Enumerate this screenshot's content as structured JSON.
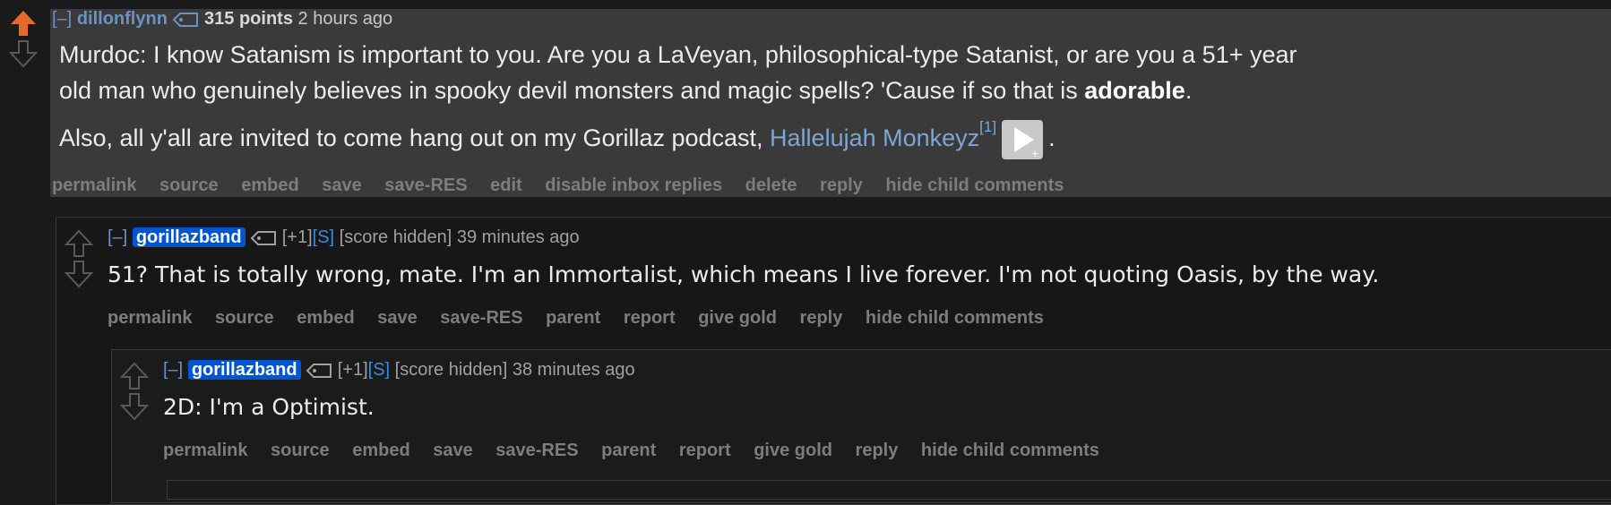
{
  "comment1": {
    "toggle": "[–]",
    "author": "dillonflynn",
    "points": "315 points",
    "time": "2 hours ago",
    "body_p1_before": "Murdoc: I know Satanism is important to you. Are you a LaVeyan, philosophical-type Satanist, or are you a 51+ year",
    "body_p1_line2": "old man who genuinely believes in spooky devil monsters and magic spells? 'Cause if so that is ",
    "body_p1_bold": "adorable",
    "body_p1_end": ".",
    "body_p2_before": "Also, all y'all are invited to come hang out on my Gorillaz podcast, ",
    "body_p2_link": "Hallelujah Monkeyz",
    "body_p2_sup": "[1]",
    "body_p2_end": ".",
    "buttons": [
      "permalink",
      "source",
      "embed",
      "save",
      "save-RES",
      "edit",
      "disable inbox replies",
      "delete",
      "reply",
      "hide child comments"
    ]
  },
  "comment2": {
    "toggle": "[–]",
    "author": "gorillazband",
    "flair_plus": "[+1]",
    "flair_s": "[S]",
    "score": "[score hidden]",
    "time": "39 minutes ago",
    "body": "51? That is totally wrong, mate. I'm an Immortalist, which means I live forever. I'm not quoting Oasis, by the way.",
    "buttons": [
      "permalink",
      "source",
      "embed",
      "save",
      "save-RES",
      "parent",
      "report",
      "give gold",
      "reply",
      "hide child comments"
    ]
  },
  "comment3": {
    "toggle": "[–]",
    "author": "gorillazband",
    "flair_plus": "[+1]",
    "flair_s": "[S]",
    "score": "[score hidden]",
    "time": "38 minutes ago",
    "body": "2D: I'm a Optimist.",
    "buttons": [
      "permalink",
      "source",
      "embed",
      "save",
      "save-RES",
      "parent",
      "report",
      "give gold",
      "reply",
      "hide child comments"
    ]
  },
  "icons": {
    "upvote_active_color": "#e8682a",
    "arrow_inactive_color": "#5a5a5a",
    "tag": "tag-icon",
    "play": "play-icon"
  }
}
